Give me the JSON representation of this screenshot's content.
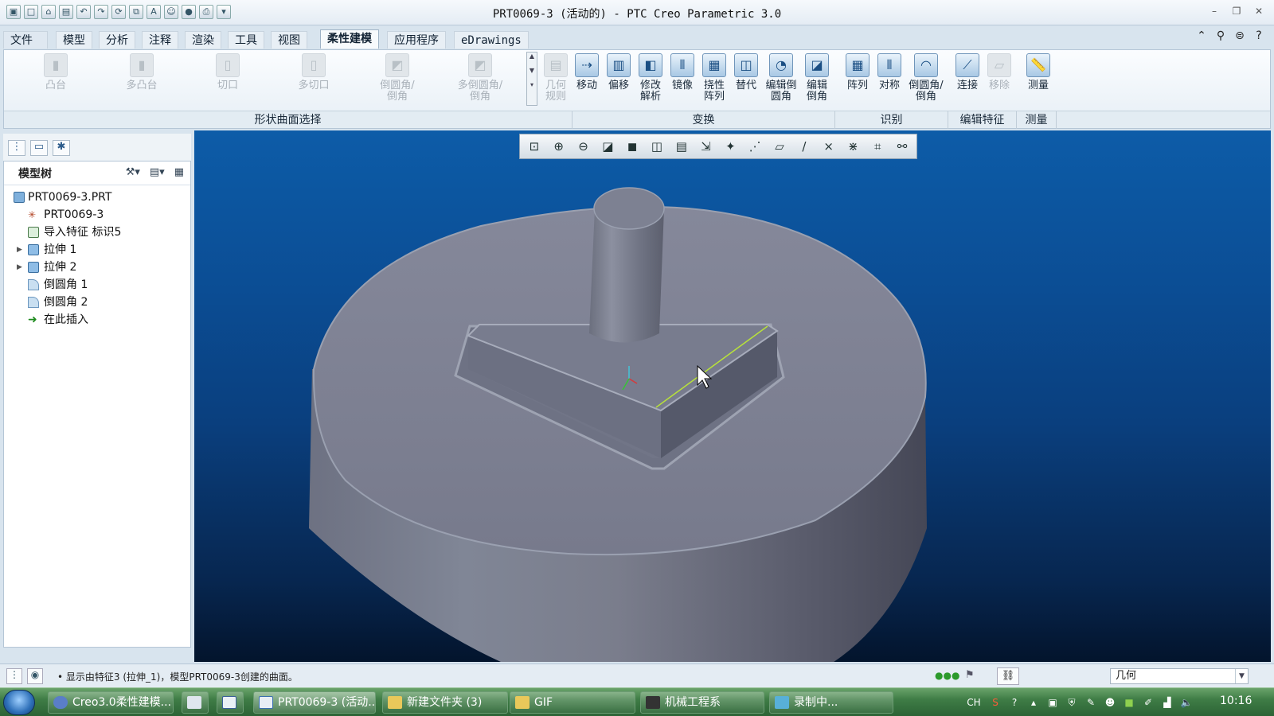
{
  "window": {
    "title": "PRT0069-3 (活动的) - PTC Creo Parametric 3.0"
  },
  "tabs": [
    {
      "label": "文件"
    },
    {
      "label": "模型"
    },
    {
      "label": "分析"
    },
    {
      "label": "注释"
    },
    {
      "label": "渲染"
    },
    {
      "label": "工具"
    },
    {
      "label": "视图"
    },
    {
      "label": "柔性建模"
    },
    {
      "label": "应用程序"
    },
    {
      "label": "eDrawings"
    }
  ],
  "ribbon": {
    "shape_buttons": [
      {
        "label": "凸台"
      },
      {
        "label": "多凸台"
      },
      {
        "label": "切口"
      },
      {
        "label": "多切口"
      },
      {
        "label": "倒圆角/\n倒角"
      },
      {
        "label": "多倒圆角/\n倒角"
      }
    ],
    "transform_buttons": [
      {
        "label": "几何\n规则"
      },
      {
        "label": "移动"
      },
      {
        "label": "偏移"
      },
      {
        "label": "修改\n解析"
      },
      {
        "label": "镜像"
      },
      {
        "label": "挠性\n阵列"
      },
      {
        "label": "替代"
      },
      {
        "label": "编辑倒\n圆角"
      },
      {
        "label": "编辑\n倒角"
      }
    ],
    "identify_buttons": [
      {
        "label": "阵列"
      },
      {
        "label": "对称"
      },
      {
        "label": "倒圆角/\n倒角"
      }
    ],
    "edit_buttons": [
      {
        "label": "连接"
      },
      {
        "label": "移除"
      }
    ],
    "measure_buttons": [
      {
        "label": "测量"
      }
    ],
    "groups": {
      "shape": "形状曲面选择",
      "transform": "变换",
      "identify": "识别",
      "edit": "编辑特征",
      "measure": "测量"
    }
  },
  "tree": {
    "header": "模型树",
    "nodes": [
      {
        "label": "PRT0069-3.PRT"
      },
      {
        "label": "PRT0069-3"
      },
      {
        "label": "导入特征 标识5"
      },
      {
        "label": "拉伸 1"
      },
      {
        "label": "拉伸 2"
      },
      {
        "label": "倒圆角 1"
      },
      {
        "label": "倒圆角 2"
      },
      {
        "label": "在此插入"
      }
    ]
  },
  "status": {
    "message": "• 显示由特征3 (拉伸_1)，模型PRT0069-3创建的曲面。",
    "filter": "几何"
  },
  "taskbar": {
    "items": [
      {
        "label": "Creo3.0柔性建模..."
      },
      {
        "label": ""
      },
      {
        "label": ""
      },
      {
        "label": "PRT0069-3 (活动..."
      },
      {
        "label": "新建文件夹 (3)"
      },
      {
        "label": "GIF"
      },
      {
        "label": "机械工程系"
      },
      {
        "label": "录制中..."
      }
    ],
    "lang": "CH",
    "clock": "10:16"
  },
  "colors": {
    "viewport_top": "#0d5ca8",
    "viewport_bottom": "#03142c",
    "model_gray": "#7c7e8e",
    "accent_tab": "#f7fafc"
  }
}
